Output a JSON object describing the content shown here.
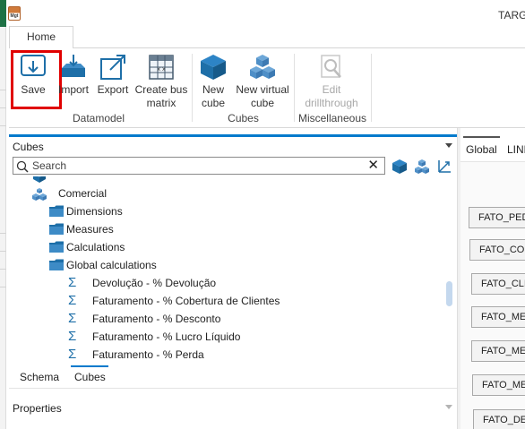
{
  "window": {
    "title_visible": "TARG",
    "app_badge": "Mgt"
  },
  "ribbon": {
    "tab": "Home",
    "buttons": {
      "save": "Save",
      "import": "Import",
      "export": "Export",
      "create_bus_matrix_line1": "Create bus",
      "create_bus_matrix_line2": "matrix",
      "new_cube_line1": "New",
      "new_cube_line2": "cube",
      "new_virtual_cube_line1": "New virtual",
      "new_virtual_cube_line2": "cube",
      "edit_drillthrough_line1": "Edit",
      "edit_drillthrough_line2": "drillthrough"
    },
    "groups": {
      "datamodel": "Datamodel",
      "cubes": "Cubes",
      "miscellaneous": "Miscellaneous"
    }
  },
  "cubes_panel": {
    "title": "Cubes",
    "search": {
      "placeholder": "Search",
      "value": ""
    },
    "tree": [
      {
        "label": "Comercial",
        "icon": "cube-group-icon"
      },
      {
        "label": "Dimensions",
        "icon": "folder-icon"
      },
      {
        "label": "Measures",
        "icon": "folder-icon"
      },
      {
        "label": "Calculations",
        "icon": "folder-icon"
      },
      {
        "label": "Global calculations",
        "icon": "folder-icon"
      },
      {
        "label": "Devolução - % Devolução",
        "icon": "sigma-icon"
      },
      {
        "label": "Faturamento - % Cobertura de Clientes",
        "icon": "sigma-icon"
      },
      {
        "label": "Faturamento - % Desconto",
        "icon": "sigma-icon"
      },
      {
        "label": "Faturamento - % Lucro Líquido",
        "icon": "sigma-icon"
      },
      {
        "label": "Faturamento - % Perda",
        "icon": "sigma-icon"
      }
    ],
    "bottom_tabs": [
      "Schema",
      "Cubes"
    ],
    "active_bottom_tab": "Cubes"
  },
  "properties_panel": {
    "title": "Properties"
  },
  "right_panel": {
    "tabs": [
      "Global",
      "LINE"
    ],
    "tables": [
      "FATO_PED",
      "FATO_COM",
      "FATO_CLIE",
      "FATO_ME",
      "FATO_ME",
      "FATO_ME",
      "FATO_DE"
    ]
  },
  "colors": {
    "accent": "#007acc",
    "highlight": "#e00000",
    "cube_blue": "#1e6fa8",
    "excel_green": "#1e7145"
  }
}
